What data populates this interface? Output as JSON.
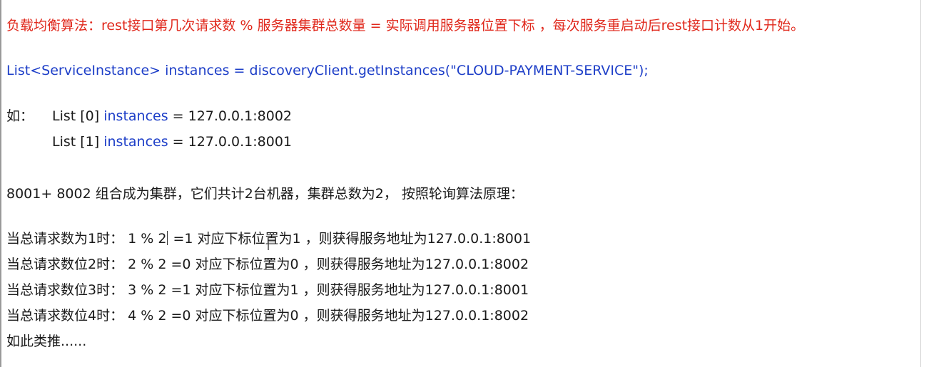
{
  "title_line": "负载均衡算法：rest接口第几次请求数 % 服务器集群总数量 = 实际调用服务器位置下标 ，每次服务重启动后rest接口计数从1开始。",
  "code_line": "List<ServiceInstance> instances = discoveryClient.getInstances(\"CLOUD-PAYMENT-SERVICE\");",
  "example": {
    "label": "如：",
    "rows": [
      {
        "prefix": "List [0] ",
        "var": "instances",
        "value": " = 127.0.0.1:8002"
      },
      {
        "prefix": "List [1] ",
        "var": "instances",
        "value": " = 127.0.0.1:8001"
      }
    ]
  },
  "cluster_line": "8001+ 8002 组合成为集群，它们共计2台机器，集群总数为2， 按照轮询算法原理：",
  "calc_rows": [
    {
      "lead": "当总请求数为1时：  1 % 2",
      "rest": " =1 对应下标位置为1 ，则获得服务地址为127.0.0.1:8001"
    },
    {
      "lead": "当总请求数位2时：  2 % 2 ",
      "rest": "=0 对应下标位置为0 ，则获得服务地址为127.0.0.1:8002"
    },
    {
      "lead": "当总请求数位3时：  3 % 2 ",
      "rest": "=1 对应下标位置为1 ，则获得服务地址为127.0.0.1:8001"
    },
    {
      "lead": "当总请求数位4时：  4 % 2 ",
      "rest": "=0 对应下标位置为0 ，则获得服务地址为127.0.0.1:8002"
    }
  ],
  "closing": "如此类推......",
  "colors": {
    "red": "#e0281c",
    "blue": "#1e3fc8",
    "text": "#1a1a1a"
  }
}
